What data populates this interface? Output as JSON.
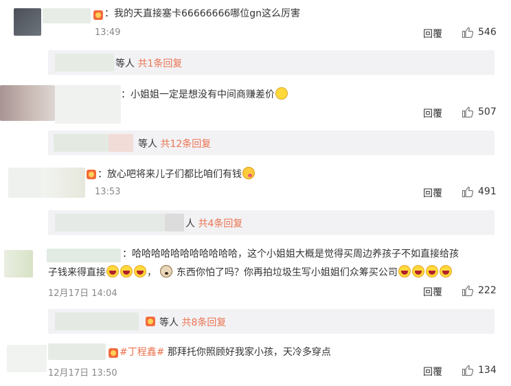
{
  "comments": [
    {
      "text": "：我的天直接塞卡66666666哪位gn这么厉害",
      "time": "13:49",
      "reply_label": "回覆",
      "likes": "546",
      "more": {
        "prefix": "等人",
        "count": "共1条回复"
      }
    },
    {
      "text": "：小姐姐一定是想没有中间商赚差价",
      "time": "",
      "reply_label": "回覆",
      "likes": "507",
      "more": {
        "prefix": "等人",
        "count": "共12条回复"
      }
    },
    {
      "text": "：放心吧将来儿子们都比咱们有钱",
      "time": "13:53",
      "reply_label": "回覆",
      "likes": "491",
      "more": {
        "prefix": "人",
        "count": "共4条回复"
      }
    },
    {
      "text_line1": "：哈哈哈哈哈哈哈哈哈哈哈，这个小姐姐大概是觉得买周边养孩子不如直接给孩",
      "text_line2a": "子钱来得直接",
      "text_line2b": "，",
      "text_line2c": "东西你怕了吗？你再拍垃圾生写小姐姐们众筹买公司",
      "time": "12月17日 14:04",
      "reply_label": "回覆",
      "likes": "222",
      "more": {
        "prefix": "等人",
        "count": "共8条回复"
      }
    },
    {
      "hashtag": "#丁程鑫#",
      "text": " 那拜托你照顾好我家小孩，天冷多穿点",
      "time": "12月17日 13:50",
      "reply_label": "回覆",
      "likes": "134"
    }
  ]
}
